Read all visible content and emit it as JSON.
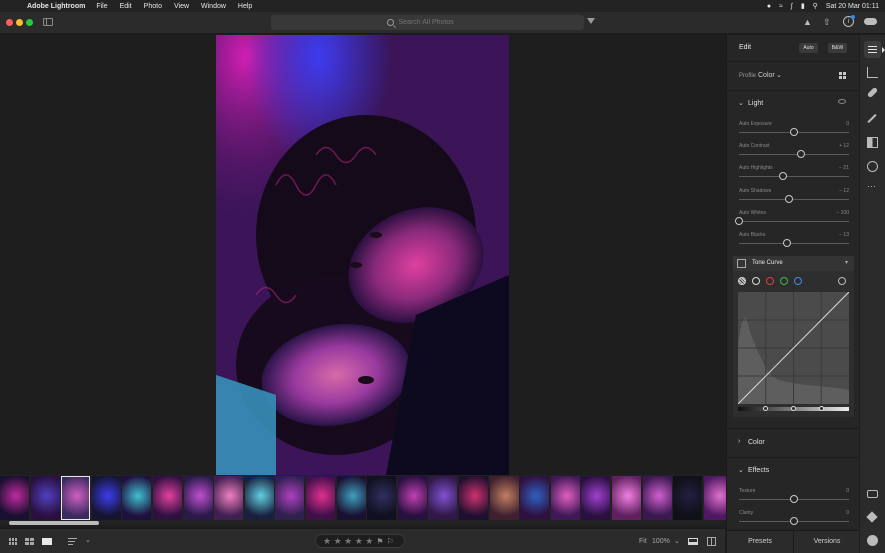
{
  "menubar": {
    "app_name": "Adobe Lightroom",
    "menus": [
      "File",
      "Edit",
      "Photo",
      "View",
      "Window",
      "Help"
    ],
    "clock": "Sat 20 Mar  01:11"
  },
  "toolbar": {
    "search_placeholder": "Search All Photos"
  },
  "edit_panel": {
    "title": "Edit",
    "auto_label": "Auto",
    "bw_label": "B&W",
    "profile_label": "Profile",
    "profile_value": "Color",
    "light": {
      "title": "Light",
      "sliders": [
        {
          "label": "Auto Exposure",
          "value": "0",
          "fraction": 0.5
        },
        {
          "label": "Auto Contrast",
          "value": "+ 12",
          "fraction": 0.56
        },
        {
          "label": "Auto Highlights",
          "value": "− 21",
          "fraction": 0.4
        },
        {
          "label": "Auto Shadows",
          "value": "− 12",
          "fraction": 0.45
        },
        {
          "label": "Auto Whites",
          "value": "− 100",
          "fraction": 0.0
        },
        {
          "label": "Auto Blacks",
          "value": "− 13",
          "fraction": 0.44
        }
      ]
    },
    "tone_curve": {
      "title": "Tone Curve"
    },
    "color": {
      "title": "Color"
    },
    "effects": {
      "title": "Effects",
      "sliders": [
        {
          "label": "Texture",
          "value": "0",
          "fraction": 0.5
        },
        {
          "label": "Clarity",
          "value": "0",
          "fraction": 0.5
        }
      ]
    }
  },
  "bottom_tabs": {
    "presets": "Presets",
    "versions": "Versions"
  },
  "bottombar": {
    "fit": "Fit",
    "zoom": "100%",
    "rating": "★ ★ ★ ★ ★",
    "rating_value": 0
  },
  "colors": {
    "accent": "#2d8ceb",
    "photo_magenta": "#d21fb4",
    "photo_blue": "#3c3cf0",
    "photo_cyan": "#3fc7d8",
    "photo_purple": "#3b1558"
  },
  "icons": [
    "apple-icon",
    "search-icon",
    "filter-icon",
    "bell-icon",
    "share-icon",
    "info-icon",
    "cloud-icon",
    "edit-sliders-icon",
    "crop-icon",
    "heal-icon",
    "brush-icon",
    "mask-icon",
    "redeye-icon",
    "more-icon",
    "comment-icon",
    "tag-icon"
  ]
}
